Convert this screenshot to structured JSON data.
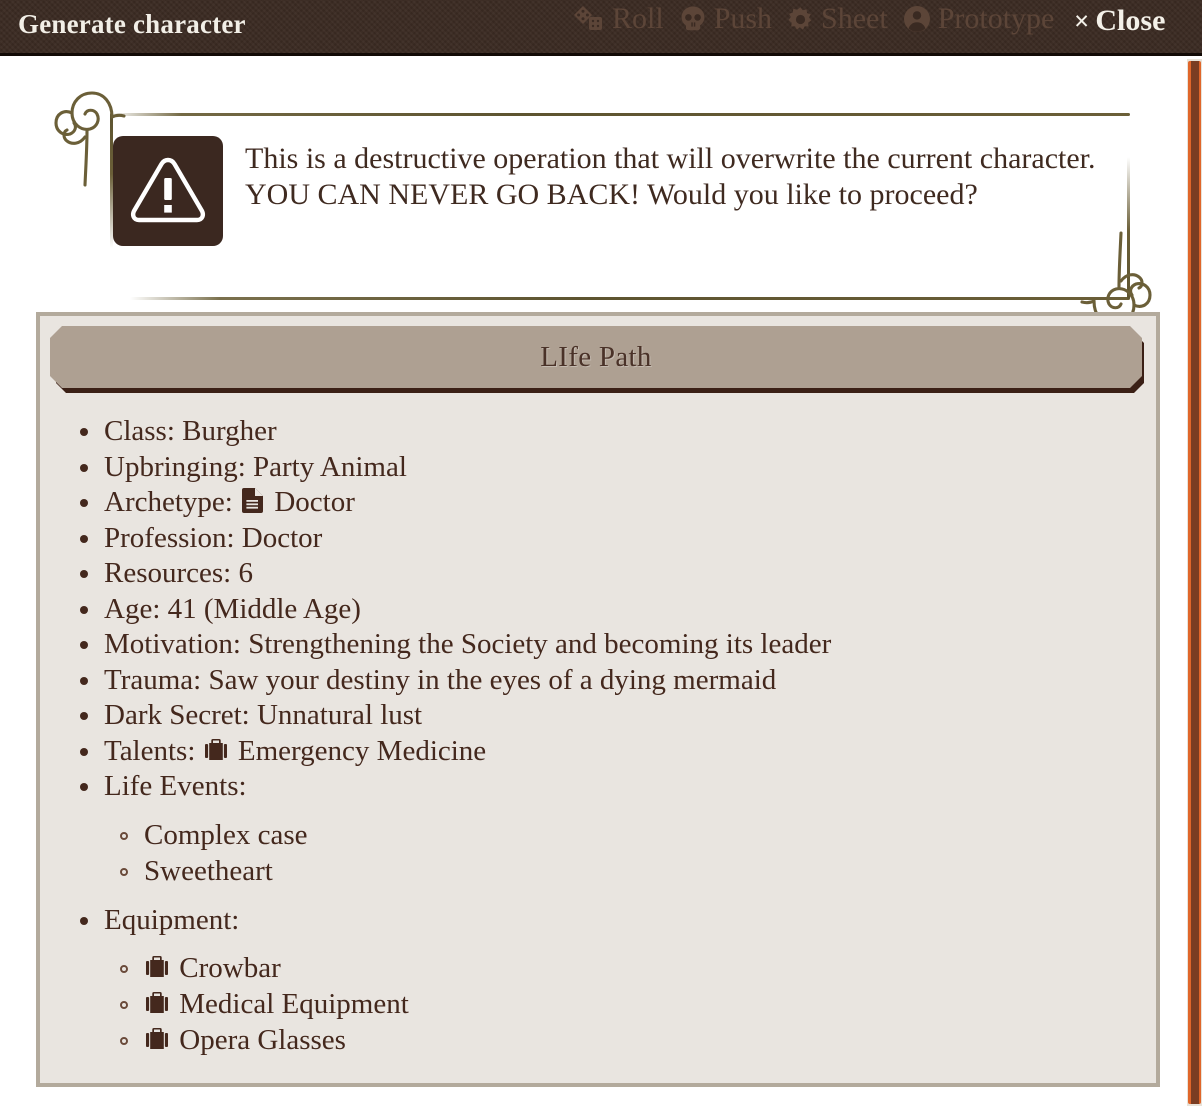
{
  "topbar": {
    "title": "Generate character",
    "nav_items": [
      {
        "label": "Roll",
        "icon": "dice-icon"
      },
      {
        "label": "Push",
        "icon": "skull-icon"
      },
      {
        "label": "Sheet",
        "icon": "gear-icon"
      },
      {
        "label": "Prototype",
        "icon": "user-circle-icon"
      }
    ],
    "close": {
      "label": "Close",
      "icon": "close-x-icon",
      "glyph": "×"
    },
    "colors": {
      "bg": "#3a2a22",
      "text": "#f2efe7",
      "nav_text": "#5c4538"
    }
  },
  "warning": {
    "icon": "warning-triangle-icon",
    "text": "This is a destructive operation that will overwrite the current character. YOU CAN NEVER GO BACK! Would you like to proceed?",
    "colors": {
      "icon_bg": "#3b2820",
      "text": "#3f2a20",
      "frame": "#6b5f38"
    }
  },
  "lifepath": {
    "banner_title": "LIfe Path",
    "colors": {
      "panel_bg": "#e9e5e0",
      "panel_border": "#b3aa9c",
      "banner_bg": "#aea092",
      "text": "#44281d"
    },
    "items": [
      {
        "label": "Class: Burgher"
      },
      {
        "label": "Upbringing: Party Animal"
      },
      {
        "label_prefix": "Archetype:",
        "icon": "document-icon",
        "label_suffix": "Doctor"
      },
      {
        "label": "Profession: Doctor"
      },
      {
        "label": "Resources: 6"
      },
      {
        "label": "Age: 41 (Middle Age)"
      },
      {
        "label": "Motivation: Strengthening the Society and becoming its leader"
      },
      {
        "label": "Trauma: Saw your destiny in the eyes of a dying mermaid"
      },
      {
        "label": "Dark Secret: Unnatural lust"
      },
      {
        "label_prefix": "Talents:",
        "icon": "briefcase-icon",
        "label_suffix": "Emergency Medicine"
      }
    ],
    "life_events": {
      "heading": "Life Events:",
      "entries": [
        {
          "label": "Complex case"
        },
        {
          "label": "Sweetheart"
        }
      ]
    },
    "equipment": {
      "heading": "Equipment:",
      "entries": [
        {
          "icon": "briefcase-icon",
          "label": "Crowbar"
        },
        {
          "icon": "briefcase-icon",
          "label": "Medical Equipment"
        },
        {
          "icon": "briefcase-icon",
          "label": "Opera Glasses"
        }
      ]
    }
  },
  "scrollbar": {
    "orientation": "vertical",
    "thumb_color": "#e0662a",
    "track_color": "#e8e2d8"
  }
}
